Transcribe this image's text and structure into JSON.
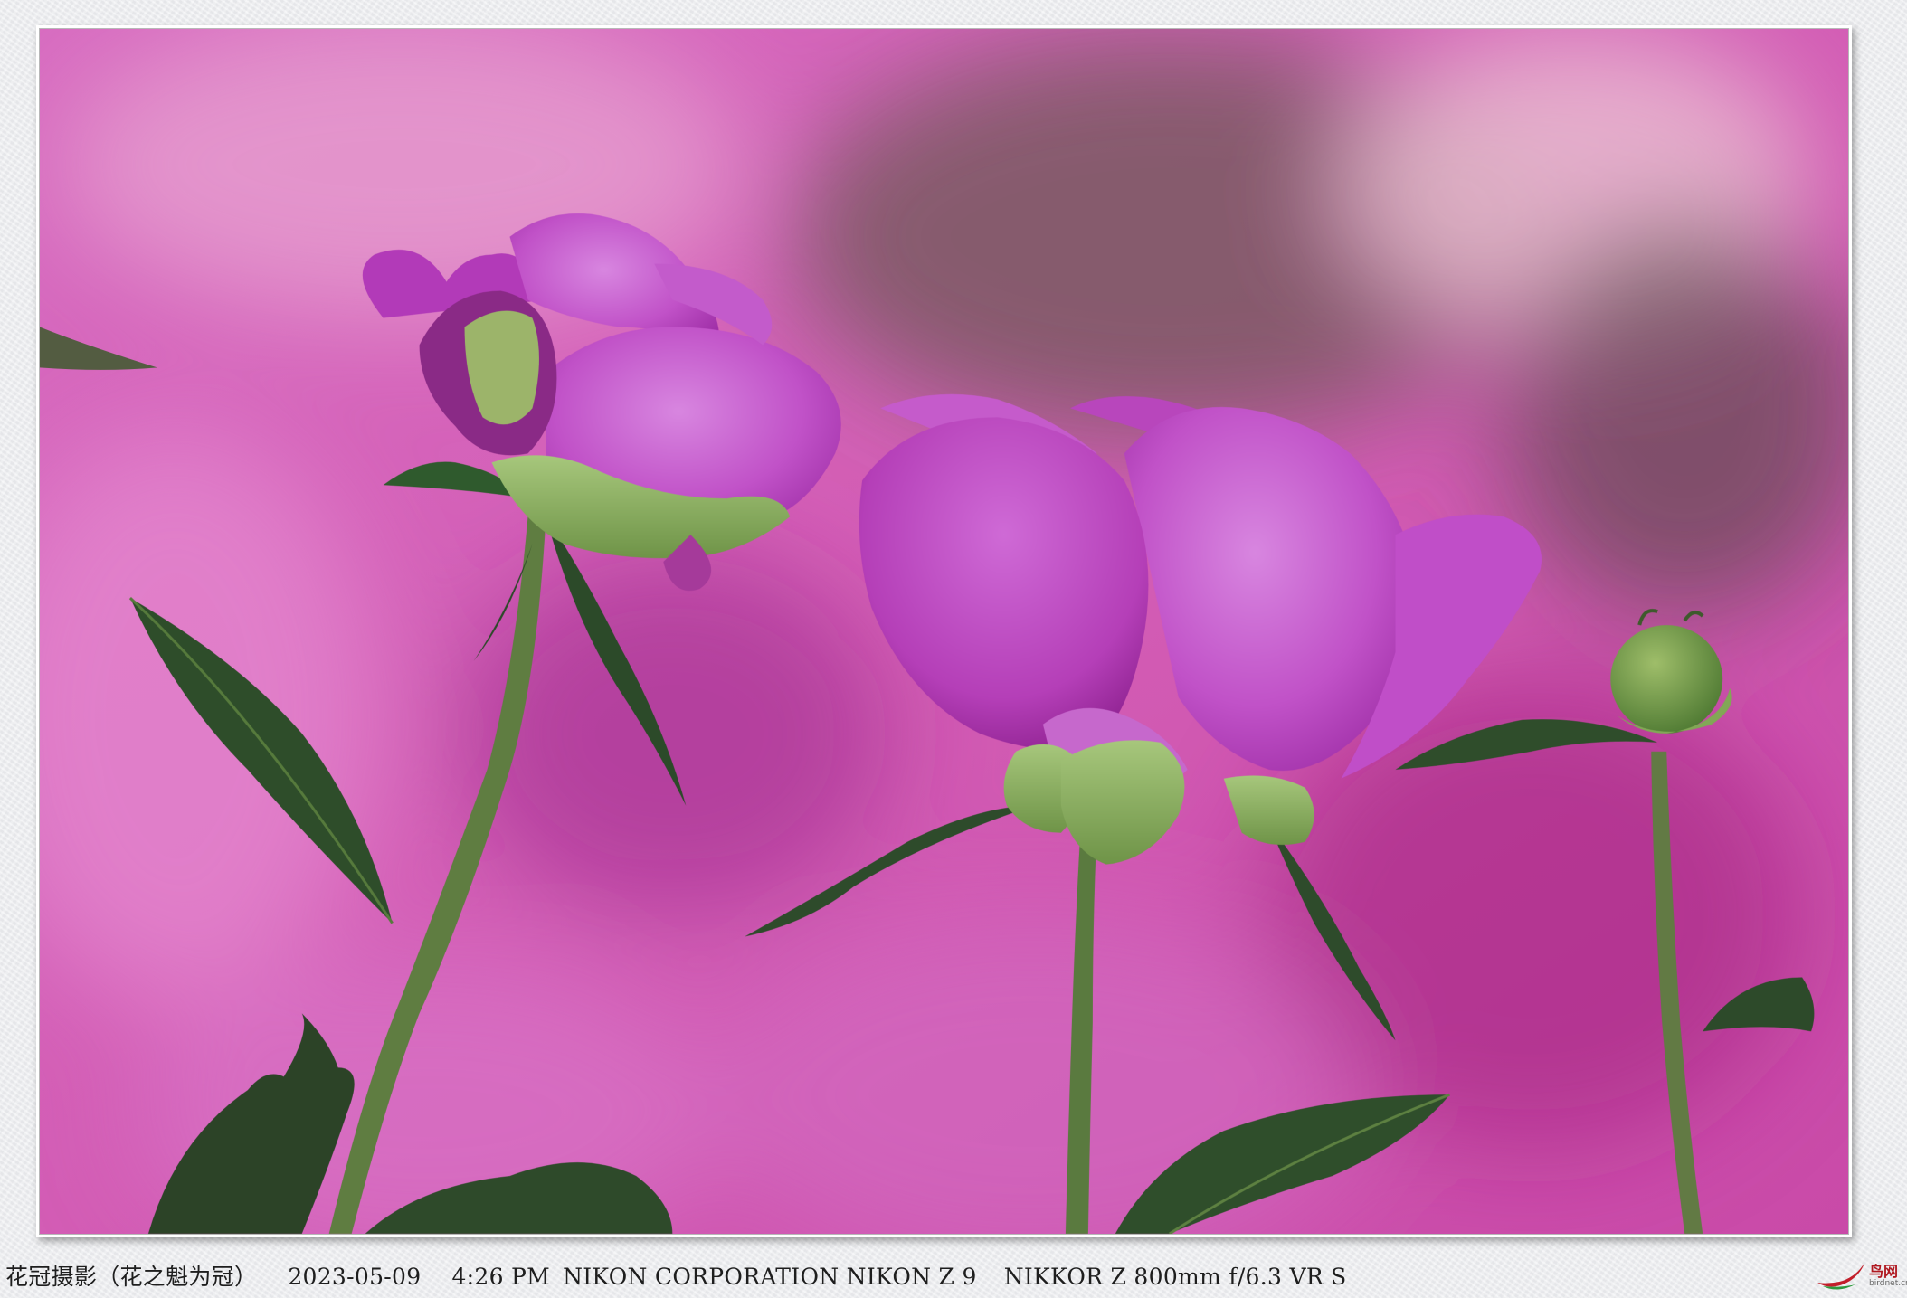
{
  "photo": {
    "subject": "pink-peony-flowers",
    "colors": {
      "background": "#d55fb8",
      "petal": "#c24fc8",
      "leaf": "#2f4a2a",
      "stem": "#5b7a3e"
    }
  },
  "caption": {
    "author": "花冠摄影（花之魁为冠）",
    "date": "2023-05-09",
    "time": "4:26 PM",
    "camera": "NIKON CORPORATION NIKON Z 9",
    "lens": "NIKKOR Z 800mm f/6.3 VR S"
  },
  "watermark": {
    "logo_icon": "bird-swoosh-logo",
    "site_name": "鸟网",
    "site_url": "birdnet.cn"
  }
}
